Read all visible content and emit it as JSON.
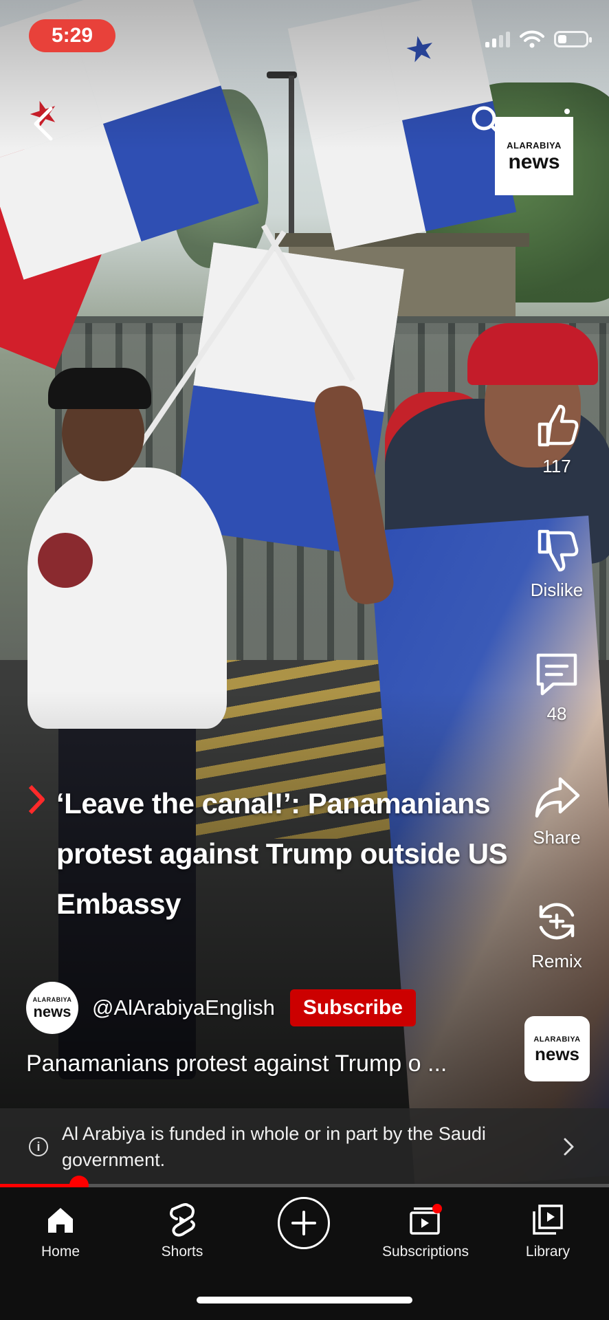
{
  "status_bar": {
    "time": "5:29"
  },
  "watermark": {
    "brand_small": "ALARABIYA",
    "brand_big": "news"
  },
  "actions": {
    "like_count": "117",
    "dislike_label": "Dislike",
    "comment_count": "48",
    "share_label": "Share",
    "remix_label": "Remix"
  },
  "video": {
    "title": "‘Leave the canal!’: Panamanians protest against Trump outside US Embassy",
    "channel_handle": "@AlArabiyaEnglish",
    "subscribe_label": "Subscribe",
    "description": "Panamanians protest against Trump o ...",
    "progress_fraction": 0.13
  },
  "info_panel": {
    "text": "Al Arabiya is funded in whole or in part by the Saudi government."
  },
  "bottom_nav": {
    "home": "Home",
    "shorts": "Shorts",
    "subscriptions": "Subscriptions",
    "library": "Library"
  },
  "colors": {
    "accent": "#ff0000",
    "subscribe_bg": "#cc0000",
    "time_pill": "#e8413a"
  }
}
